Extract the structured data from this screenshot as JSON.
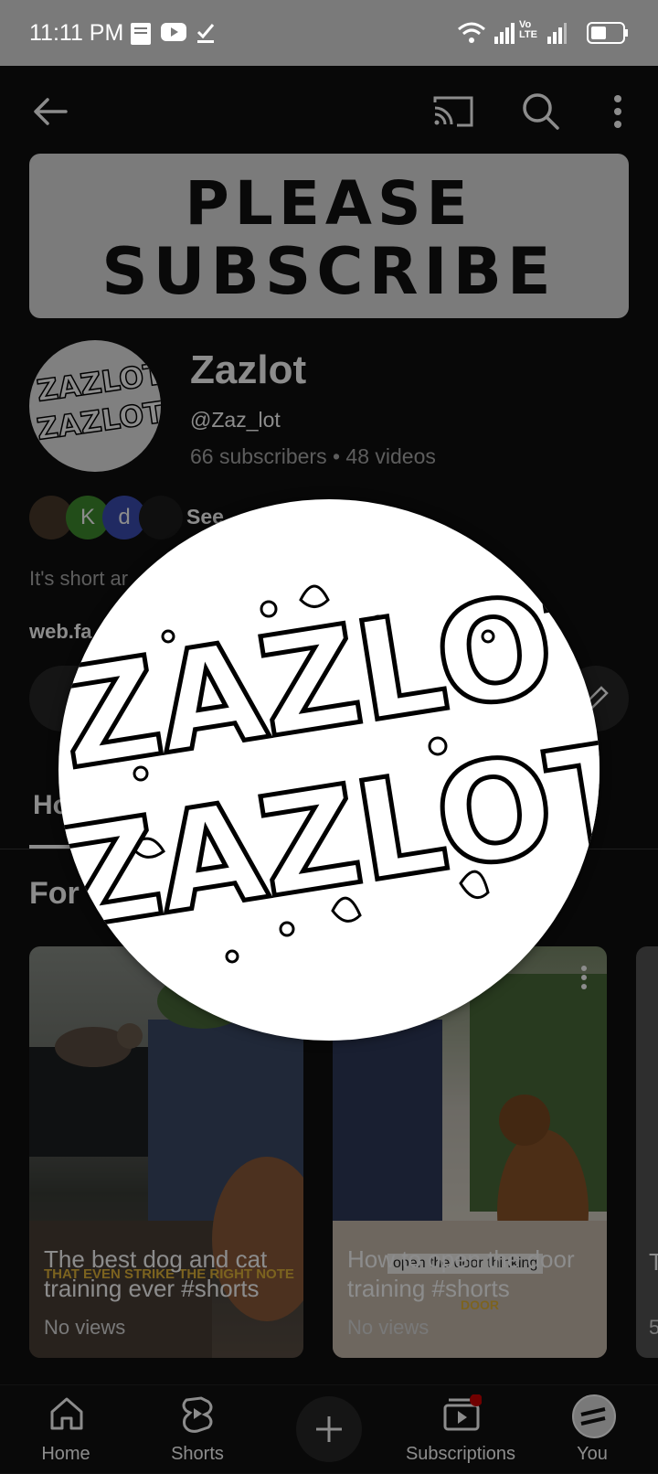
{
  "status_bar": {
    "time": "11:11 PM",
    "icons": [
      "bible-app-icon",
      "youtube-icon",
      "check-icon",
      "wifi-icon",
      "signal-icon",
      "volte-icon",
      "signal-icon",
      "battery-icon"
    ],
    "volte_label": "Vo LTE"
  },
  "top_bar": {
    "icons": [
      "back-arrow-icon",
      "cast-icon",
      "search-icon",
      "more-vert-icon"
    ]
  },
  "banner": {
    "line1": "PLEASE",
    "line2": "SUBSCRIBE"
  },
  "channel": {
    "name": "Zazlot",
    "handle": "@Zaz_lot",
    "subscribers": "66 subscribers",
    "separator": "•",
    "videos": "48 videos",
    "avatar_text_1": "ZAZLOT",
    "avatar_text_2": "ZAZLOT",
    "subscriber_avatars": [
      "",
      "K",
      "d",
      ""
    ],
    "see_text": "See",
    "description": "It's short ar",
    "link": "web.fa"
  },
  "tabs": {
    "home": "Ho"
  },
  "section": {
    "title": "For"
  },
  "videos": [
    {
      "title": "The best dog and cat training ever #shorts",
      "views": "No views",
      "overlay_caption": "THAT EVEN STRIKE THE RIGHT NOTE"
    },
    {
      "title": "How to open the door training #shorts",
      "views": "No views",
      "overlay_caption": "open the door thinking",
      "overlay_caption_2": "DOOR"
    },
    {
      "title": "T",
      "views": "5"
    }
  ],
  "bottom_nav": [
    {
      "label": "Home",
      "icon": "home-icon"
    },
    {
      "label": "Shorts",
      "icon": "shorts-icon"
    },
    {
      "label": "",
      "icon": "create-plus-icon"
    },
    {
      "label": "Subscriptions",
      "icon": "subscriptions-icon"
    },
    {
      "label": "You",
      "icon": "profile-avatar-icon"
    }
  ],
  "colors": {
    "background": "#0f0f0f",
    "status_bar": "#7a7a7a",
    "notification_dot": "#cc0000",
    "secondary_text": "#aaaaaa"
  }
}
